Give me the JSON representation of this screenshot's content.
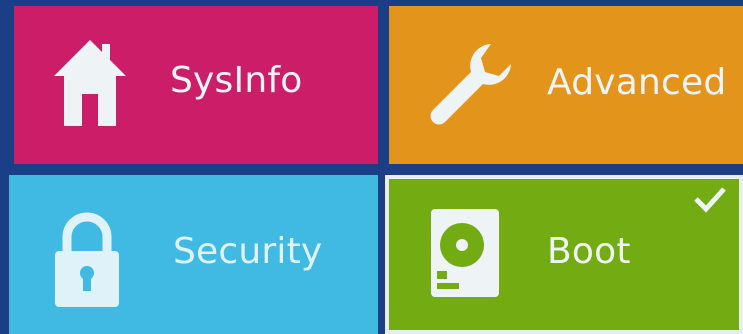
{
  "tiles": [
    {
      "id": "sysinfo",
      "label": "SysInfo",
      "icon": "house-icon",
      "color": "#cc1e68"
    },
    {
      "id": "advanced",
      "label": "Advanced",
      "icon": "wrench-icon",
      "color": "#e2941b"
    },
    {
      "id": "security",
      "label": "Security",
      "icon": "padlock-icon",
      "color": "#40b9e3"
    },
    {
      "id": "boot",
      "label": "Boot",
      "icon": "hard-drive-icon",
      "color": "#72ab12",
      "selected": true
    }
  ],
  "background_color": "#1b3f86",
  "selected_indicator_icon": "checkmark-icon"
}
